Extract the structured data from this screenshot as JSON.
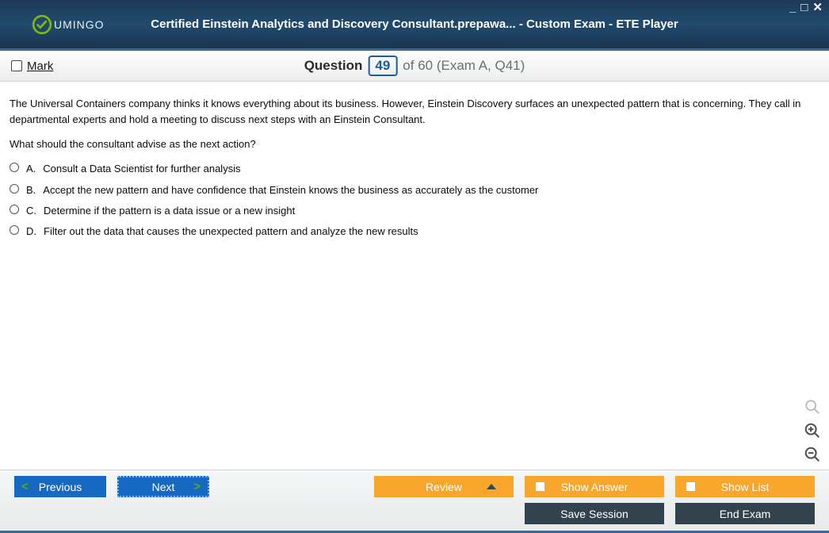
{
  "app": {
    "brand": "UMINGO",
    "title": "Certified Einstein Analytics and Discovery Consultant.prepawa... - Custom Exam - ETE Player"
  },
  "questionBar": {
    "markLabel": "Mark",
    "questionWord": "Question",
    "number": "49",
    "rest": "of 60 (Exam A, Q41)"
  },
  "question": {
    "stem": "The Universal Containers company thinks it knows everything about its business. However, Einstein Discovery surfaces an unexpected pattern that is concerning. They call in departmental experts and hold a meeting to discuss next steps with an Einstein Consultant.",
    "prompt": "What should the consultant advise as the next action?",
    "choices": [
      {
        "letter": "A.",
        "text": "Consult a Data Scientist for further analysis"
      },
      {
        "letter": "B.",
        "text": "Accept the new pattern and have confidence that Einstein knows the business as accurately as the customer"
      },
      {
        "letter": "C.",
        "text": "Determine if the pattern is a data issue or a new insight"
      },
      {
        "letter": "D.",
        "text": "Filter out the data that causes the unexpected pattern and analyze the new results"
      }
    ]
  },
  "footer": {
    "previous": "Previous",
    "next": "Next",
    "review": "Review",
    "showAnswer": "Show Answer",
    "showList": "Show List",
    "saveSession": "Save Session",
    "endExam": "End Exam"
  }
}
